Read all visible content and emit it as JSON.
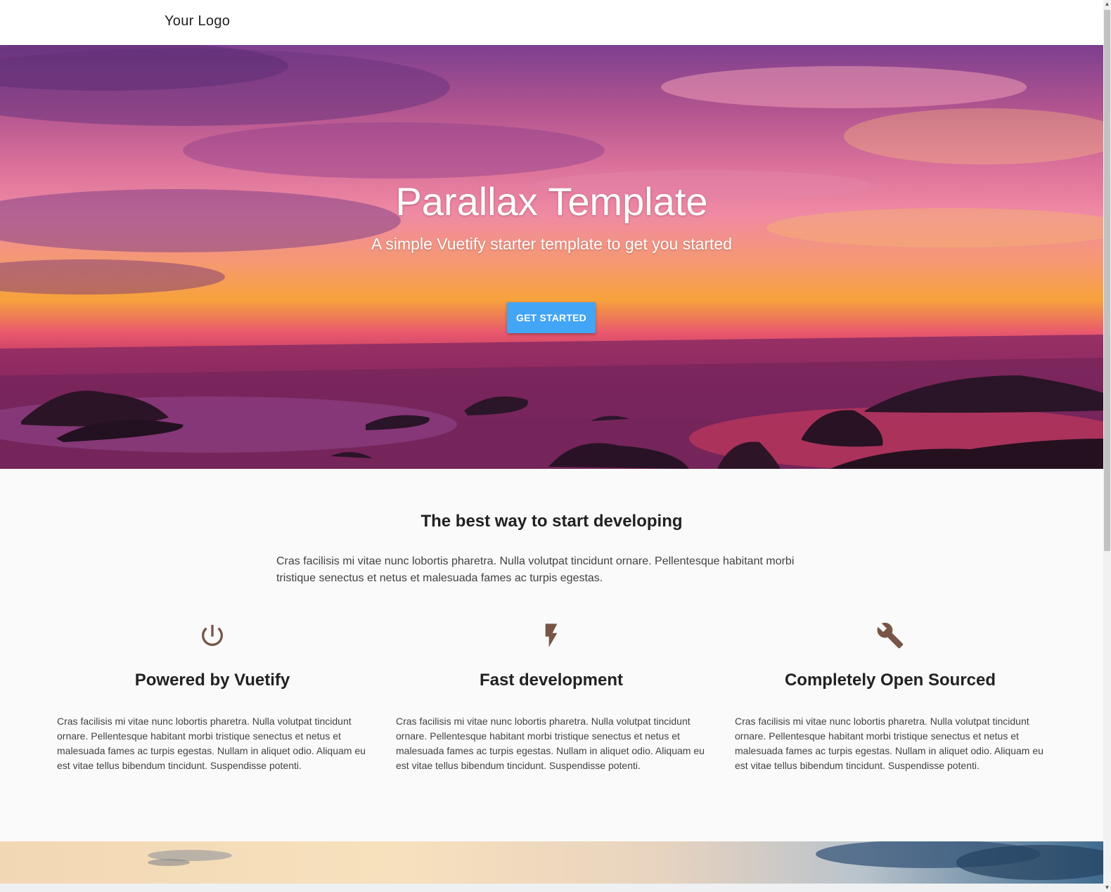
{
  "toolbar": {
    "logo": "Your Logo"
  },
  "hero": {
    "title": "Parallax Template",
    "subtitle": "A simple Vuetify starter template to get you started",
    "cta_label": "GET STARTED",
    "cta_color": "#42a5f5"
  },
  "intro": {
    "title": "The best way to start developing",
    "text": "Cras facilisis mi vitae nunc lobortis pharetra. Nulla volutpat tincidunt ornare. Pellentesque habitant morbi tristique senectus et netus et malesuada fames ac turpis egestas."
  },
  "features": [
    {
      "icon": "power-icon",
      "title": "Powered by Vuetify",
      "text": "Cras facilisis mi vitae nunc lobortis pharetra. Nulla volutpat tincidunt ornare. Pellentesque habitant morbi tristique senectus et netus et malesuada fames ac turpis egestas. Nullam in aliquet odio. Aliquam eu est vitae tellus bibendum tincidunt. Suspendisse potenti."
    },
    {
      "icon": "flash-icon",
      "title": "Fast development",
      "text": "Cras facilisis mi vitae nunc lobortis pharetra. Nulla volutpat tincidunt ornare. Pellentesque habitant morbi tristique senectus et netus et malesuada fames ac turpis egestas. Nullam in aliquet odio. Aliquam eu est vitae tellus bibendum tincidunt. Suspendisse potenti."
    },
    {
      "icon": "wrench-icon",
      "title": "Completely Open Sourced",
      "text": "Cras facilisis mi vitae nunc lobortis pharetra. Nulla volutpat tincidunt ornare. Pellentesque habitant morbi tristique senectus et netus et malesuada fames ac turpis egestas. Nullam in aliquet odio. Aliquam eu est vitae tellus bibendum tincidunt. Suspendisse potenti."
    }
  ],
  "icon_color": "#795548"
}
